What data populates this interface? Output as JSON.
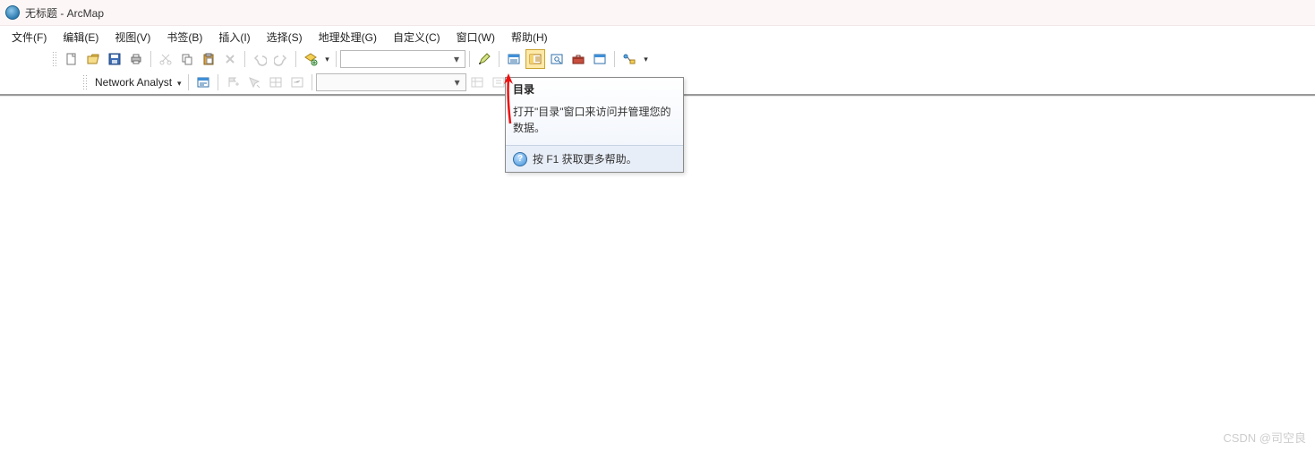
{
  "window": {
    "title": "无标题 - ArcMap"
  },
  "menubar": {
    "items": [
      "文件(F)",
      "编辑(E)",
      "视图(V)",
      "书签(B)",
      "插入(I)",
      "选择(S)",
      "地理处理(G)",
      "自定义(C)",
      "窗口(W)",
      "帮助(H)"
    ]
  },
  "toolbar1": {
    "scale_combo": ""
  },
  "toolbar2": {
    "label": "Network Analyst",
    "layer_combo": ""
  },
  "tooltip": {
    "title": "目录",
    "body": "打开\"目录\"窗口来访问并管理您的数据。",
    "footer": "按 F1 获取更多帮助。"
  },
  "watermark": "CSDN @司空良"
}
